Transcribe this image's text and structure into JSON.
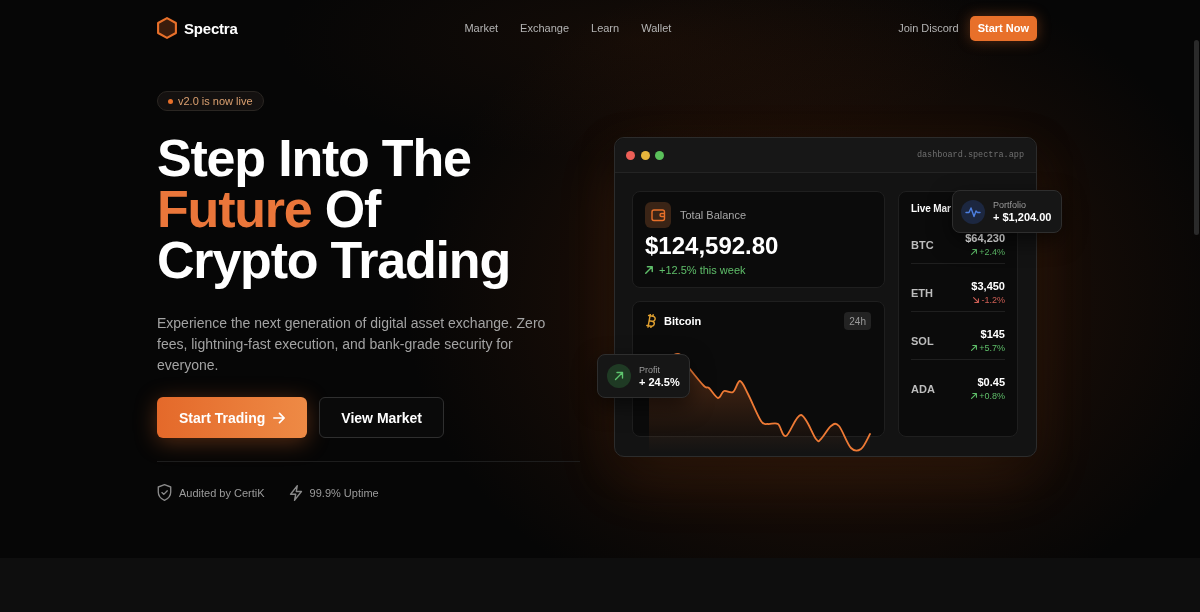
{
  "header": {
    "logo": "Spectra",
    "nav": [
      {
        "label": "Market"
      },
      {
        "label": "Exchange"
      },
      {
        "label": "Learn"
      },
      {
        "label": "Wallet"
      }
    ],
    "link": "Join Discord",
    "cta": "Start Now"
  },
  "hero": {
    "badge": "v2.0 is now live",
    "headline": [
      [
        {
          "text": "Step Into The",
          "accent": false
        }
      ],
      [
        {
          "text": "Future",
          "accent": true
        },
        {
          "text": "Of",
          "accent": false
        }
      ],
      [
        {
          "text": "Crypto Trading",
          "accent": false
        }
      ]
    ],
    "description": "Experience the next generation of digital asset exchange. Zero fees, lightning-fast execution, and bank-grade security for everyone.",
    "buttons": [
      {
        "label": "Start Trading",
        "kind": "primary"
      },
      {
        "label": "View Market",
        "kind": "secondary"
      }
    ],
    "trust": [
      {
        "kind": "shield",
        "label": "Audited by CertiK"
      },
      {
        "kind": "bolt",
        "label": "99.9% Uptime"
      }
    ]
  },
  "dashboard": {
    "url": "dashboard.spectra.app",
    "balance": {
      "label": "Total Balance",
      "amount": "$124,592.80",
      "change": "+12.5% this week",
      "rising": true
    },
    "chart": {
      "title": "Bitcoin",
      "range": "24h"
    },
    "market": {
      "title": "Live Mar",
      "rows": [
        {
          "symbol": "BTC",
          "price": "$64,230",
          "change": "+2.4%",
          "rising": true
        },
        {
          "symbol": "ETH",
          "price": "$3,450",
          "change": "-1.2%",
          "rising": false
        },
        {
          "symbol": "SOL",
          "price": "$145",
          "change": "+5.7%",
          "rising": true
        },
        {
          "symbol": "ADA",
          "price": "$0.45",
          "change": "+0.8%",
          "rising": true
        }
      ]
    },
    "portfolio_popup": {
      "label": "Portfolio",
      "value": "+ $1,204.00"
    },
    "profit_popup": {
      "label": "Profit",
      "value": "+ 24.5%"
    }
  }
}
